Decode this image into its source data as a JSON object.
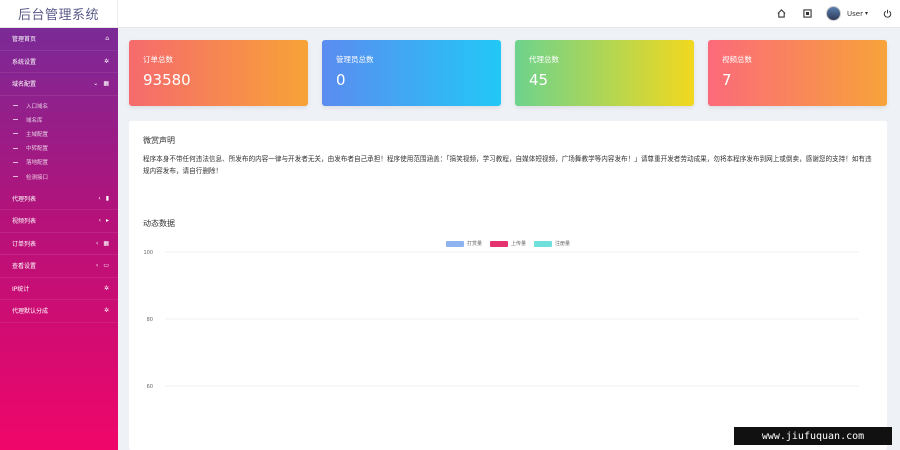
{
  "app": {
    "title": "后台管理系统"
  },
  "topbar": {
    "icons": [
      "home-icon",
      "fullscreen-icon",
      "power-icon"
    ],
    "user": {
      "name": "User",
      "caret": "▾"
    }
  },
  "sidebar": {
    "items": [
      {
        "label": "管理首页",
        "icon": "home-icon",
        "glyph": "⌂"
      },
      {
        "label": "系统设置",
        "icon": "gear-icon",
        "glyph": "✲"
      },
      {
        "label": "域名配置",
        "icon": "calendar-icon",
        "glyph": "▦",
        "arrow": "⌄",
        "expanded": true,
        "children": [
          "入口域名",
          "域名库",
          "主域配置",
          "中转配置",
          "落地配置",
          "检测接口"
        ]
      },
      {
        "label": "代理列表",
        "icon": "user-icon",
        "glyph": "▮",
        "arrow": "‹"
      },
      {
        "label": "视频列表",
        "icon": "play-icon",
        "glyph": "▸",
        "arrow": "‹"
      },
      {
        "label": "订单列表",
        "icon": "calendar-icon",
        "glyph": "▦",
        "arrow": "‹"
      },
      {
        "label": "查看设置",
        "icon": "laptop-icon",
        "glyph": "▭",
        "arrow": "‹"
      },
      {
        "label": "IP统计",
        "icon": "gear-icon",
        "glyph": "✲"
      },
      {
        "label": "代理默认分成",
        "icon": "gear-icon",
        "glyph": "✲"
      }
    ]
  },
  "stats": [
    {
      "title": "订单总数",
      "value": "93580"
    },
    {
      "title": "管理员总数",
      "value": "0"
    },
    {
      "title": "代理总数",
      "value": "45"
    },
    {
      "title": "视频总数",
      "value": "7"
    }
  ],
  "notice": {
    "title": "微赏声明",
    "text": "程序本身不带任何违法信息、所发布的内容一律与开发者无关，由发布者自己承担！程序使用范围涵盖：「搞笑视频，学习教程，自媒体短视频，广场舞教学等内容发布！」请尊重开发者劳动成果，勿将本程序发布到网上或倒卖，感谢您的支持！如有违规内容发布，请自行删除！"
  },
  "chart": {
    "title": "动态数据",
    "legend": [
      {
        "name": "打赏量",
        "color": "#8fb3ee"
      },
      {
        "name": "上传量",
        "color": "#e4336f"
      },
      {
        "name": "注册量",
        "color": "#6fe0da"
      }
    ]
  },
  "chart_data": {
    "type": "line",
    "title": "动态数据",
    "yticks": [
      100,
      80,
      60
    ],
    "ylim": [
      60,
      100
    ],
    "series": [
      {
        "name": "打赏量",
        "values": []
      },
      {
        "name": "上传量",
        "values": []
      },
      {
        "name": "注册量",
        "values": []
      }
    ],
    "grid": true,
    "legend_position": "top"
  },
  "watermark": {
    "text": "www.jiufuquan.com"
  }
}
